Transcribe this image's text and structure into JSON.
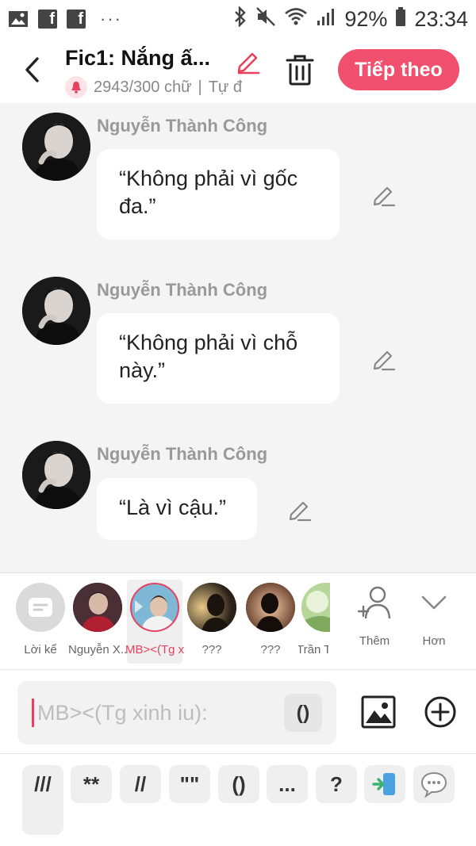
{
  "status_bar": {
    "fb1": "f",
    "fb2": "f",
    "dots": "···",
    "battery": "92%",
    "time": "23:34"
  },
  "header": {
    "title": "Fic1: Nắng ấ...",
    "word_count": "2943/300 chữ",
    "separator": "|",
    "mode": "Tự đ",
    "next_label": "Tiếp theo",
    "accent": "#f0506e"
  },
  "messages": [
    {
      "sender": "Nguyễn Thành Công",
      "text": "“Không phải vì gốc đa.”"
    },
    {
      "sender": "Nguyễn Thành Công",
      "text": "“Không phải vì chỗ này.”"
    },
    {
      "sender": "Nguyễn Thành Công",
      "text": "“Là vì cậu.”"
    }
  ],
  "characters": [
    {
      "name": "Lời kể"
    },
    {
      "name": "Nguyễn X..."
    },
    {
      "name": "MB><(Tg x..."
    },
    {
      "name": "???"
    },
    {
      "name": "???"
    },
    {
      "name": "Trần T..."
    }
  ],
  "actions": {
    "add_label": "Thêm",
    "more_label": "Hơn"
  },
  "composer": {
    "placeholder": "MB><(Tg xinh iu):",
    "paren": "()"
  },
  "quick_symbols": [
    "///",
    "**",
    "//",
    "\"\"",
    "()",
    "...",
    "?"
  ]
}
